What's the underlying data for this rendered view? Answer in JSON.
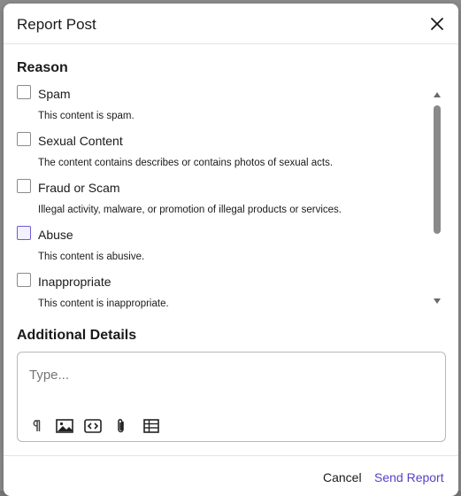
{
  "dialog": {
    "title": "Report Post",
    "reason_heading": "Reason",
    "reasons": [
      {
        "label": "Spam",
        "description": "This content is spam."
      },
      {
        "label": "Sexual Content",
        "description": "The content contains describes or contains photos of sexual acts."
      },
      {
        "label": "Fraud or Scam",
        "description": "Illegal activity, malware, or promotion of illegal products or services."
      },
      {
        "label": "Abuse",
        "description": "This content is abusive."
      },
      {
        "label": "Inappropriate",
        "description": "This content is inappropriate."
      }
    ],
    "details_heading": "Additional Details",
    "details_placeholder": "Type...",
    "toolbar_icons": [
      "paragraph-icon",
      "image-icon",
      "code-icon",
      "attachment-icon",
      "table-icon"
    ],
    "cancel_label": "Cancel",
    "send_label": "Send Report"
  },
  "colors": {
    "accent": "#5a3fc8",
    "hover_checkbox_border": "#6b5bd2"
  }
}
